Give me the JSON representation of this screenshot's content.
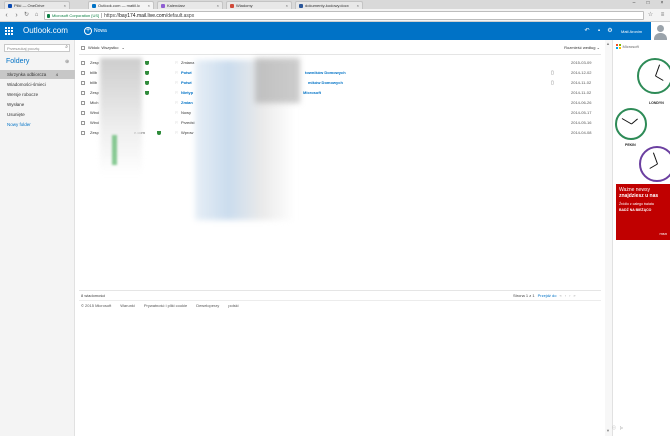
{
  "browser": {
    "tabs": [
      {
        "title": "Pliki — OneDrive",
        "favicon_color": "#094ab2",
        "active": false
      },
      {
        "title": "Outlook.com — matiil.lc",
        "favicon_color": "#0072c6",
        "active": true
      },
      {
        "title": "Kalendarz",
        "favicon_color": "#8e5dd2",
        "active": false
      },
      {
        "title": "Wiadomy",
        "favicon_color": "#d04a3a",
        "active": false
      },
      {
        "title": "dokumenty-kodowy.docx",
        "favicon_color": "#2b579a",
        "active": false
      }
    ],
    "address_ev": "Microsoft Corporation [US]",
    "address_scheme": "https://",
    "address_host": "bay174.mail.live.com",
    "address_path": "/default.aspx"
  },
  "header": {
    "brand": "Outlook.com",
    "new_label": "Nowa",
    "user_name": "Mati Aronim"
  },
  "left": {
    "search_placeholder": "Przeszukaj pocztę",
    "folders_title": "Foldery",
    "folders": [
      {
        "label": "Skrzynka odbiorcza",
        "count": "4",
        "active": true
      },
      {
        "label": "Wiadomości-śmieci",
        "count": "",
        "active": false
      },
      {
        "label": "Wersje robocze",
        "count": "",
        "active": false
      },
      {
        "label": "Wysłane",
        "count": "",
        "active": false
      },
      {
        "label": "Usunięte",
        "count": "",
        "active": false
      }
    ],
    "new_folder": "Nowy folder"
  },
  "list": {
    "select_label": "Widok: Wszystko",
    "sort_label": "Rozmieść według",
    "messages": [
      {
        "from": "Zesp",
        "subject": "Zmiana",
        "date": "2015-03-09",
        "unread": false,
        "attachment": false,
        "shield": true
      },
      {
        "from": "billb",
        "subject": "Potwi",
        "subject_tail": "towników Domowych",
        "date": "2014-12-02",
        "unread": true,
        "attachment": true,
        "shield": true
      },
      {
        "from": "billb",
        "subject": "Potwi",
        "subject_tail": "mików Domowych",
        "date": "2014-11-02",
        "unread": true,
        "attachment": true,
        "shield": true
      },
      {
        "from": "Zesp",
        "subject": "Nietyp",
        "subject_tail": "Microsoft",
        "date": "2014-11-02",
        "unread": true,
        "attachment": false,
        "shield": true
      },
      {
        "from": "Mich",
        "subject": "Zmian",
        "date": "2014-06-26",
        "unread": true,
        "attachment": false,
        "shield": false
      },
      {
        "from": "Wind",
        "subject": "Nowy",
        "date": "2014-05-17",
        "unread": false,
        "attachment": false,
        "shield": false
      },
      {
        "from": "Wind",
        "subject": "Przedst",
        "date": "2014-05-16",
        "unread": false,
        "attachment": false,
        "shield": false
      },
      {
        "from": "Zesp",
        "from_tail": "e.com",
        "subject": "Wprow",
        "date": "2014-04-08",
        "unread": false,
        "attachment": false,
        "shield": true
      }
    ],
    "count_text": "8 wiadomości",
    "page_text": "Strona 1 z 1",
    "goto_text": "Przejdź do"
  },
  "footer": {
    "links": [
      "© 2015 Microsoft",
      "Warunki",
      "Prywatność i pliki cookie",
      "Deweloperzy",
      "polski"
    ]
  },
  "ad": {
    "brand": "Microsoft",
    "cities": [
      "LONDYN",
      "PEKIN"
    ],
    "line1": "Ważne newsy",
    "line2": "znajdziesz u nas",
    "line3": "Źródło z całego świata",
    "line4": "BADŹ NA BIEŻĄCO",
    "line5": "msn"
  }
}
